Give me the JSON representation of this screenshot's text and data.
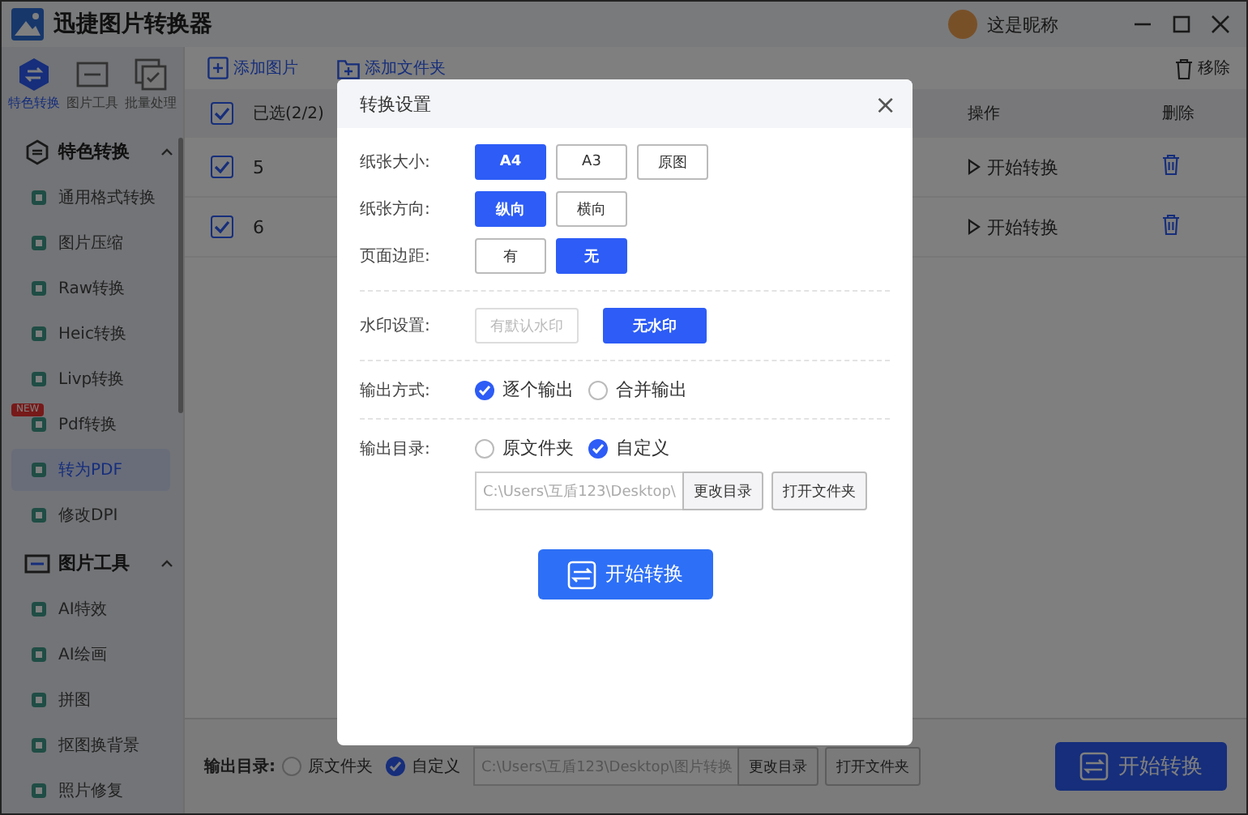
{
  "app": {
    "title": "迅捷图片转换器",
    "user_name": "这是昵称"
  },
  "sidebar": {
    "tabs": [
      {
        "label": "特色转换",
        "selected": true
      },
      {
        "label": "图片工具",
        "selected": false
      },
      {
        "label": "批量处理",
        "selected": false
      }
    ],
    "groups": [
      {
        "label": "特色转换",
        "expanded": true,
        "items": [
          {
            "label": "通用格式转换",
            "selected": false
          },
          {
            "label": "图片压缩",
            "selected": false
          },
          {
            "label": "Raw转换",
            "selected": false
          },
          {
            "label": "Heic转换",
            "selected": false
          },
          {
            "label": "Livp转换",
            "selected": false
          },
          {
            "label": "Pdf转换",
            "selected": false,
            "badge": "NEW"
          },
          {
            "label": "转为PDF",
            "selected": true
          },
          {
            "label": "修改DPI",
            "selected": false
          }
        ]
      },
      {
        "label": "图片工具",
        "expanded": true,
        "items": [
          {
            "label": "AI特效",
            "selected": false
          },
          {
            "label": "AI绘画",
            "selected": false
          },
          {
            "label": "拼图",
            "selected": false
          },
          {
            "label": "抠图换背景",
            "selected": false
          },
          {
            "label": "照片修复",
            "selected": false
          }
        ]
      }
    ]
  },
  "toolbar": {
    "add_image": "添加图片",
    "add_folder": "添加文件夹",
    "remove": "移除"
  },
  "table": {
    "all_checked": true,
    "selection": "已选(2/2)",
    "col_action": "操作",
    "col_delete": "删除",
    "rows": [
      {
        "name": "5",
        "checked": true,
        "action": "开始转换"
      },
      {
        "name": "6",
        "checked": true,
        "action": "开始转换"
      }
    ]
  },
  "bottom": {
    "label": "输出目录:",
    "options": [
      {
        "label": "原文件夹",
        "selected": false
      },
      {
        "label": "自定义",
        "selected": true
      }
    ],
    "path": "C:\\Users\\互盾123\\Desktop\\图片转换",
    "change_dir": "更改目录",
    "open_folder": "打开文件夹",
    "start": "开始转换"
  },
  "dialog": {
    "title": "转换设置",
    "close": "×",
    "choices": [
      {
        "label": "纸张大小:",
        "options": [
          {
            "label": "A4",
            "selected": true,
            "disabled": false
          },
          {
            "label": "A3",
            "selected": false,
            "disabled": false
          },
          {
            "label": "原图",
            "selected": false,
            "disabled": false
          }
        ]
      },
      {
        "label": "纸张方向:",
        "options": [
          {
            "label": "纵向",
            "selected": true,
            "disabled": false
          },
          {
            "label": "横向",
            "selected": false,
            "disabled": false
          }
        ]
      },
      {
        "label": "页面边距:",
        "options": [
          {
            "label": "有",
            "selected": false,
            "disabled": false
          },
          {
            "label": "无",
            "selected": true,
            "disabled": false
          }
        ]
      }
    ],
    "watermark": {
      "label": "水印设置:",
      "options": [
        {
          "label": "有默认水印",
          "selected": false,
          "disabled": true
        },
        {
          "label": "无水印",
          "selected": true,
          "disabled": false
        }
      ]
    },
    "output_mode": {
      "label": "输出方式:",
      "options": [
        {
          "label": "逐个输出",
          "selected": true
        },
        {
          "label": "合并输出",
          "selected": false
        }
      ]
    },
    "output_dir": {
      "label": "输出目录:",
      "options": [
        {
          "label": "原文件夹",
          "selected": false
        },
        {
          "label": "自定义",
          "selected": true
        }
      ],
      "path": "C:\\Users\\互盾123\\Desktop\\",
      "change_dir": "更改目录",
      "open_folder": "打开文件夹"
    },
    "start": "开始转换"
  }
}
